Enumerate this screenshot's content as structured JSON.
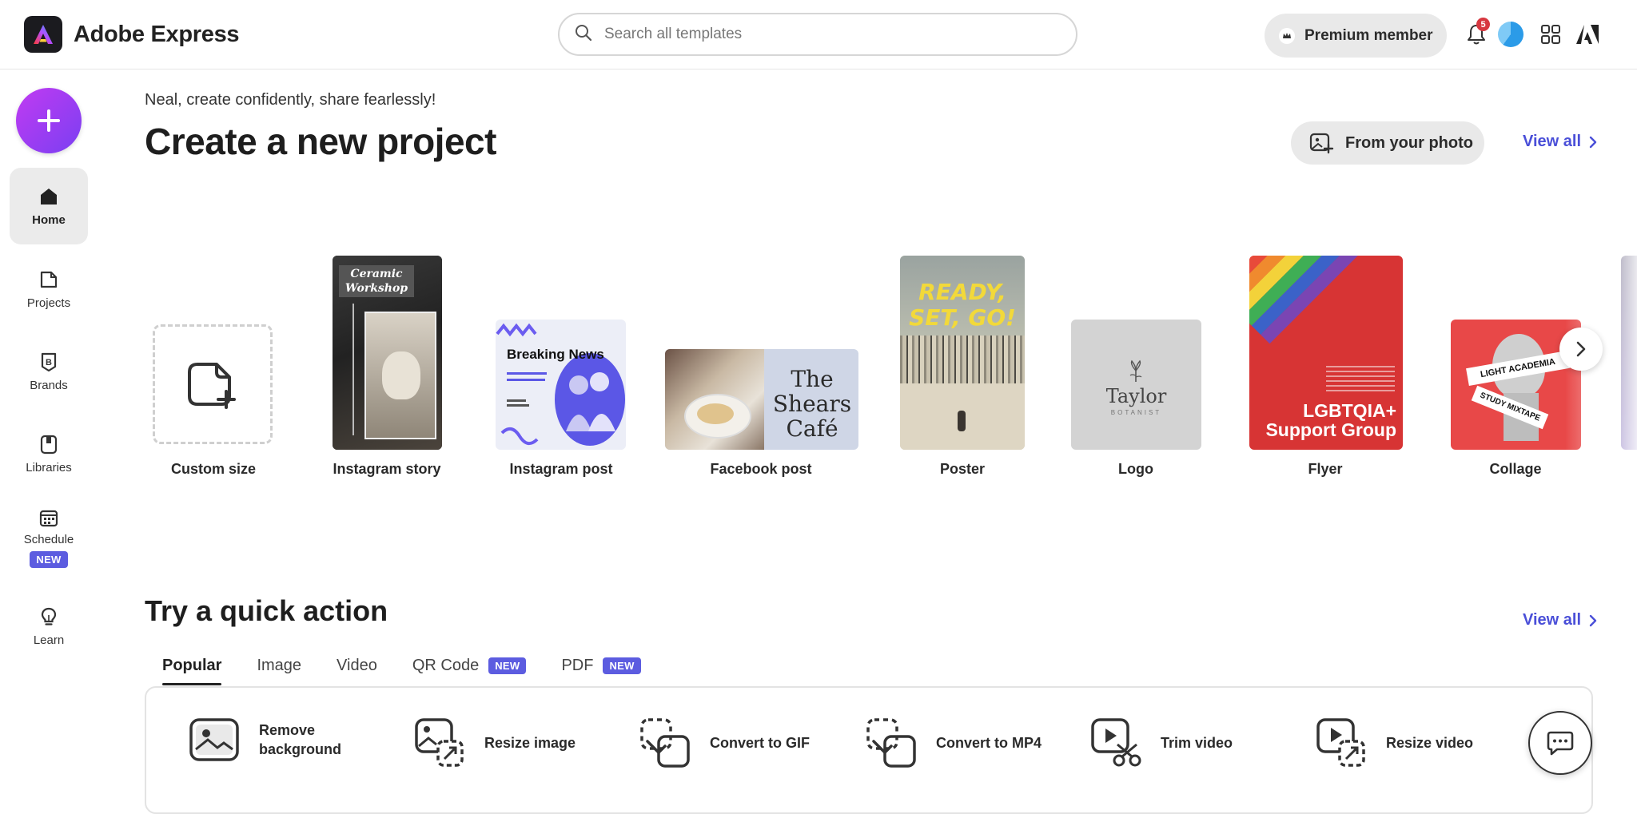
{
  "app": {
    "name": "Adobe Express"
  },
  "search": {
    "placeholder": "Search all templates"
  },
  "header": {
    "premium_label": "Premium member",
    "notification_count": "5"
  },
  "sidebar": {
    "items": [
      {
        "label": "Home",
        "icon": "home-icon",
        "active": true
      },
      {
        "label": "Projects",
        "icon": "projects-icon"
      },
      {
        "label": "Brands",
        "icon": "brand-icon"
      },
      {
        "label": "Libraries",
        "icon": "libraries-icon"
      },
      {
        "label": "Schedule",
        "icon": "calendar-icon",
        "badge": "NEW"
      },
      {
        "label": "Learn",
        "icon": "lightbulb-icon"
      }
    ]
  },
  "main": {
    "greeting": "Neal, create confidently, share fearlessly!",
    "title": "Create a new project",
    "from_photo": "From your photo",
    "view_all": "View all",
    "templates": [
      {
        "label": "Custom size"
      },
      {
        "label": "Instagram story",
        "thumb_text": "Ceramic Workshop"
      },
      {
        "label": "Instagram post",
        "thumb_text": "Breaking News"
      },
      {
        "label": "Facebook post",
        "thumb_text": "The Shears Café"
      },
      {
        "label": "Poster",
        "thumb_text": "READY, SET, GO!"
      },
      {
        "label": "Logo",
        "thumb_text": "Taylor",
        "thumb_sub": "BOTANIST"
      },
      {
        "label": "Flyer",
        "thumb_text": "LGBTQIA+ Support Group"
      },
      {
        "label": "Collage",
        "thumb_text": "LIGHT ACADEMIA",
        "thumb_sub": "STUDY MIXTAPE"
      }
    ]
  },
  "quick": {
    "title": "Try a quick action",
    "view_all": "View all",
    "tabs": [
      {
        "label": "Popular",
        "active": true
      },
      {
        "label": "Image"
      },
      {
        "label": "Video"
      },
      {
        "label": "QR Code",
        "badge": "NEW"
      },
      {
        "label": "PDF",
        "badge": "NEW"
      }
    ],
    "actions": [
      {
        "label_line1": "Remove",
        "label_line2": "background",
        "icon": "remove-background-icon"
      },
      {
        "label": "Resize image",
        "icon": "resize-image-icon"
      },
      {
        "label": "Convert to GIF",
        "icon": "convert-gif-icon"
      },
      {
        "label": "Convert to MP4",
        "icon": "convert-mp4-icon"
      },
      {
        "label": "Trim video",
        "icon": "trim-video-icon"
      },
      {
        "label": "Resize video",
        "icon": "resize-video-icon"
      }
    ]
  },
  "colors": {
    "accent": "#4a4fd8",
    "new_badge": "#5c5ce0",
    "create_gradient_start": "#c13bf2",
    "create_gradient_end": "#7a3ff2"
  }
}
